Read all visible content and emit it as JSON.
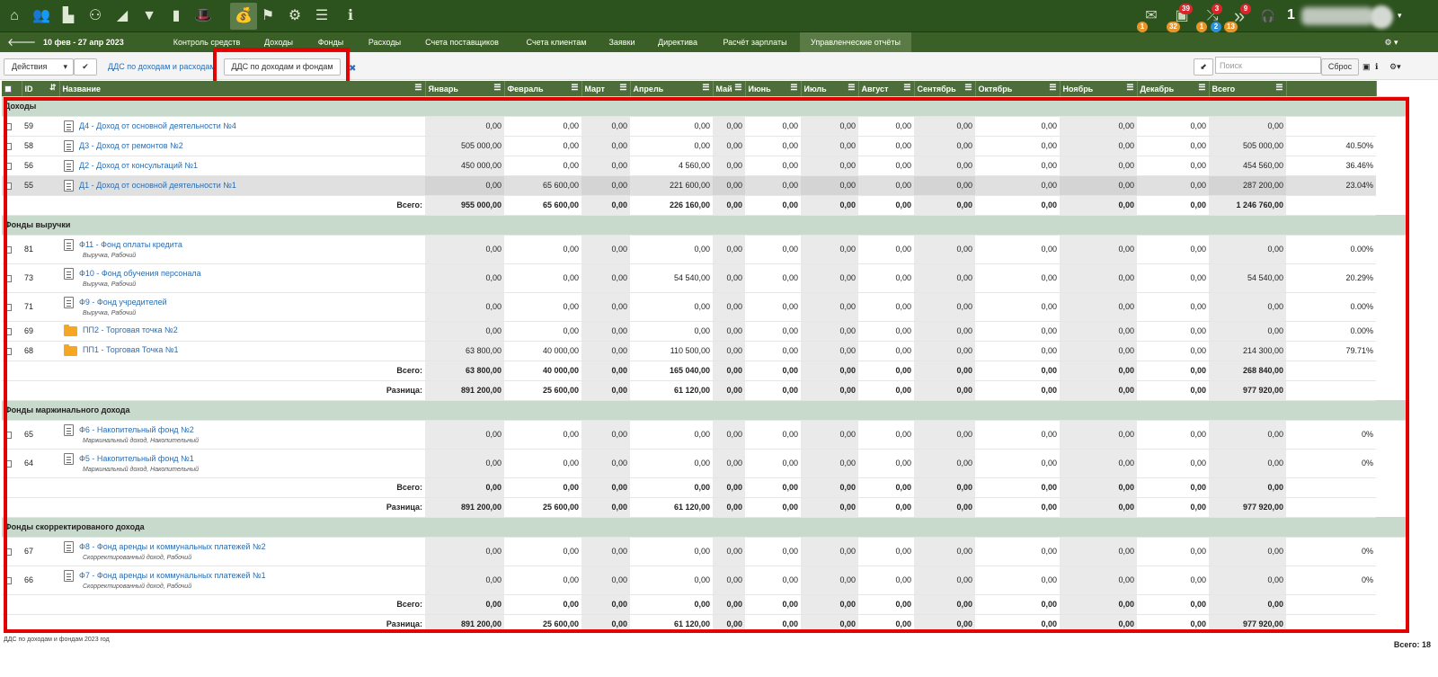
{
  "toolbar": {
    "icons": [
      "home-icon",
      "users-icon",
      "factory-icon",
      "org-structure-icon",
      "growth-chart-icon",
      "funnel-icon",
      "bar-chart-icon",
      "hat-icon",
      "moneybag-icon",
      "flag-icon",
      "gear-icon",
      "list-icon",
      "info-icon"
    ],
    "glyphs": [
      "⌂",
      "👥",
      "▙",
      "⚇",
      "◢",
      "▼",
      "▮",
      "🎩",
      "💰",
      "⚑",
      "⚙",
      "☰",
      "ℹ"
    ],
    "right": {
      "mail_badge": "1",
      "mail_glyph": "✉",
      "clip_badge_top": "39",
      "clip_badge_bottom": "32",
      "clip_glyph": "▣",
      "shuffle_badge_top": "3",
      "shuffle_badge_b1": "1",
      "shuffle_badge_b2": "2",
      "shuffle_glyph": "⤮",
      "next_badge_top": "9",
      "next_badge_bottom": "13",
      "next_glyph": "»",
      "headset_glyph": "🎧",
      "user_num": "1",
      "caret": "▾"
    }
  },
  "nav": {
    "back": "🡐",
    "period": "10 фев - 27 апр 2023",
    "items": [
      "Контроль средств",
      "Доходы",
      "Фонды",
      "Расходы",
      "Счета поставщиков",
      "Счета клиентам",
      "Заявки",
      "Директива",
      "Расчёт зарплаты",
      "Управленческие отчёты"
    ],
    "settings": "⚙ ▾"
  },
  "actions": {
    "label": "Действия",
    "caret": "▾",
    "check": "✔",
    "tab1": "ДДС по доходам и расходам",
    "tab2": "ДДС по доходам и фондам",
    "pin": "✖",
    "collapse": "⬋",
    "search_placeholder": "Поиск",
    "reset": "Сброс",
    "print": "▣",
    "info": "ℹ",
    "gear": "⚙▾"
  },
  "table": {
    "headers": [
      "ID",
      "Название",
      "Январь",
      "Февраль",
      "Март",
      "Апрель",
      "Май",
      "Июнь",
      "Июль",
      "Август",
      "Сентябрь",
      "Октябрь",
      "Ноябрь",
      "Декабрь",
      "Всего"
    ],
    "menu": "☰",
    "sort": "⇵",
    "rows": [
      {
        "type": "section",
        "title": "Доходы"
      },
      {
        "type": "item",
        "id": "59",
        "icon": "doc",
        "name": "Д4 - Доход от основной деятельности №4",
        "sub": "",
        "vals": [
          "0,00",
          "0,00",
          "0,00",
          "0,00",
          "0,00",
          "0,00",
          "0,00",
          "0,00",
          "0,00",
          "0,00",
          "0,00",
          "0,00",
          "0,00"
        ],
        "pct": ""
      },
      {
        "type": "item",
        "id": "58",
        "icon": "doc",
        "name": "Д3 - Доход от ремонтов №2",
        "sub": "",
        "vals": [
          "505 000,00",
          "0,00",
          "0,00",
          "0,00",
          "0,00",
          "0,00",
          "0,00",
          "0,00",
          "0,00",
          "0,00",
          "0,00",
          "0,00",
          "505 000,00"
        ],
        "pct": "40.50%"
      },
      {
        "type": "item",
        "id": "56",
        "icon": "doc",
        "name": "Д2 - Доход от консультаций №1",
        "sub": "",
        "vals": [
          "450 000,00",
          "0,00",
          "0,00",
          "4 560,00",
          "0,00",
          "0,00",
          "0,00",
          "0,00",
          "0,00",
          "0,00",
          "0,00",
          "0,00",
          "454 560,00"
        ],
        "pct": "36.46%"
      },
      {
        "type": "item",
        "id": "55",
        "icon": "doc",
        "name": "Д1 - Доход от основной деятельности №1",
        "sub": "",
        "sel": true,
        "vals": [
          "0,00",
          "65 600,00",
          "0,00",
          "221 600,00",
          "0,00",
          "0,00",
          "0,00",
          "0,00",
          "0,00",
          "0,00",
          "0,00",
          "0,00",
          "287 200,00"
        ],
        "pct": "23.04%"
      },
      {
        "type": "total",
        "label": "Всего:",
        "vals": [
          "955 000,00",
          "65 600,00",
          "0,00",
          "226 160,00",
          "0,00",
          "0,00",
          "0,00",
          "0,00",
          "0,00",
          "0,00",
          "0,00",
          "0,00",
          "1 246 760,00"
        ]
      },
      {
        "type": "section",
        "title": "Фонды выручки"
      },
      {
        "type": "item",
        "id": "81",
        "icon": "doc",
        "name": "Ф11 - Фонд оплаты кредита",
        "sub": "Выручка, Рабочий",
        "vals": [
          "0,00",
          "0,00",
          "0,00",
          "0,00",
          "0,00",
          "0,00",
          "0,00",
          "0,00",
          "0,00",
          "0,00",
          "0,00",
          "0,00",
          "0,00"
        ],
        "pct": "0.00%"
      },
      {
        "type": "item",
        "id": "73",
        "icon": "doc",
        "name": "Ф10 - Фонд обучения персонала",
        "sub": "Выручка, Рабочий",
        "vals": [
          "0,00",
          "0,00",
          "0,00",
          "54 540,00",
          "0,00",
          "0,00",
          "0,00",
          "0,00",
          "0,00",
          "0,00",
          "0,00",
          "0,00",
          "54 540,00"
        ],
        "pct": "20.29%"
      },
      {
        "type": "item",
        "id": "71",
        "icon": "doc",
        "name": "Ф9 - Фонд учредителей",
        "sub": "Выручка, Рабочий",
        "vals": [
          "0,00",
          "0,00",
          "0,00",
          "0,00",
          "0,00",
          "0,00",
          "0,00",
          "0,00",
          "0,00",
          "0,00",
          "0,00",
          "0,00",
          "0,00"
        ],
        "pct": "0.00%"
      },
      {
        "type": "item",
        "id": "69",
        "icon": "folder",
        "name": "ПП2 - Торговая точка №2",
        "sub": "",
        "vals": [
          "0,00",
          "0,00",
          "0,00",
          "0,00",
          "0,00",
          "0,00",
          "0,00",
          "0,00",
          "0,00",
          "0,00",
          "0,00",
          "0,00",
          "0,00"
        ],
        "pct": "0.00%"
      },
      {
        "type": "item",
        "id": "68",
        "icon": "folder",
        "name": "ПП1 - Торговая Точка №1",
        "sub": "",
        "vals": [
          "63 800,00",
          "40 000,00",
          "0,00",
          "110 500,00",
          "0,00",
          "0,00",
          "0,00",
          "0,00",
          "0,00",
          "0,00",
          "0,00",
          "0,00",
          "214 300,00"
        ],
        "pct": "79.71%"
      },
      {
        "type": "total",
        "label": "Всего:",
        "vals": [
          "63 800,00",
          "40 000,00",
          "0,00",
          "165 040,00",
          "0,00",
          "0,00",
          "0,00",
          "0,00",
          "0,00",
          "0,00",
          "0,00",
          "0,00",
          "268 840,00"
        ]
      },
      {
        "type": "total",
        "label": "Разница:",
        "vals": [
          "891 200,00",
          "25 600,00",
          "0,00",
          "61 120,00",
          "0,00",
          "0,00",
          "0,00",
          "0,00",
          "0,00",
          "0,00",
          "0,00",
          "0,00",
          "977 920,00"
        ]
      },
      {
        "type": "section",
        "title": "Фонды маржинального дохода"
      },
      {
        "type": "item",
        "id": "65",
        "icon": "doc",
        "name": "Ф6 - Накопительный фонд №2",
        "sub": "Маржинальный доход, Накопительный",
        "vals": [
          "0,00",
          "0,00",
          "0,00",
          "0,00",
          "0,00",
          "0,00",
          "0,00",
          "0,00",
          "0,00",
          "0,00",
          "0,00",
          "0,00",
          "0,00"
        ],
        "pct": "0%"
      },
      {
        "type": "item",
        "id": "64",
        "icon": "doc",
        "name": "Ф5 - Накопительный фонд №1",
        "sub": "Маржинальный доход, Накопительный",
        "vals": [
          "0,00",
          "0,00",
          "0,00",
          "0,00",
          "0,00",
          "0,00",
          "0,00",
          "0,00",
          "0,00",
          "0,00",
          "0,00",
          "0,00",
          "0,00"
        ],
        "pct": "0%"
      },
      {
        "type": "total",
        "label": "Всего:",
        "vals": [
          "0,00",
          "0,00",
          "0,00",
          "0,00",
          "0,00",
          "0,00",
          "0,00",
          "0,00",
          "0,00",
          "0,00",
          "0,00",
          "0,00",
          "0,00"
        ]
      },
      {
        "type": "total",
        "label": "Разница:",
        "vals": [
          "891 200,00",
          "25 600,00",
          "0,00",
          "61 120,00",
          "0,00",
          "0,00",
          "0,00",
          "0,00",
          "0,00",
          "0,00",
          "0,00",
          "0,00",
          "977 920,00"
        ]
      },
      {
        "type": "section",
        "title": "Фонды скорректированого дохода"
      },
      {
        "type": "item",
        "id": "67",
        "icon": "doc",
        "name": "Ф8 - Фонд аренды и коммунальных платежей №2",
        "sub": "Скорректированный доход, Рабочий",
        "vals": [
          "0,00",
          "0,00",
          "0,00",
          "0,00",
          "0,00",
          "0,00",
          "0,00",
          "0,00",
          "0,00",
          "0,00",
          "0,00",
          "0,00",
          "0,00"
        ],
        "pct": "0%"
      },
      {
        "type": "item",
        "id": "66",
        "icon": "doc",
        "name": "Ф7 - Фонд аренды и коммунальных платежей №1",
        "sub": "Скорректированный доход, Рабочий",
        "vals": [
          "0,00",
          "0,00",
          "0,00",
          "0,00",
          "0,00",
          "0,00",
          "0,00",
          "0,00",
          "0,00",
          "0,00",
          "0,00",
          "0,00",
          "0,00"
        ],
        "pct": "0%"
      },
      {
        "type": "total",
        "label": "Всего:",
        "vals": [
          "0,00",
          "0,00",
          "0,00",
          "0,00",
          "0,00",
          "0,00",
          "0,00",
          "0,00",
          "0,00",
          "0,00",
          "0,00",
          "0,00",
          "0,00"
        ]
      },
      {
        "type": "total",
        "label": "Разница:",
        "vals": [
          "891 200,00",
          "25 600,00",
          "0,00",
          "61 120,00",
          "0,00",
          "0,00",
          "0,00",
          "0,00",
          "0,00",
          "0,00",
          "0,00",
          "0,00",
          "977 920,00"
        ]
      }
    ]
  },
  "footer": {
    "caption": "ДДС по доходам и фондам 2023 год",
    "total": "Всего: 18"
  },
  "colors": {
    "toolbar": "#2c521e",
    "navbar": "#3b6027",
    "header": "#4d6e3b",
    "section": "#c8dacb",
    "highlight": "#e20000",
    "link": "#2a6eb3"
  }
}
